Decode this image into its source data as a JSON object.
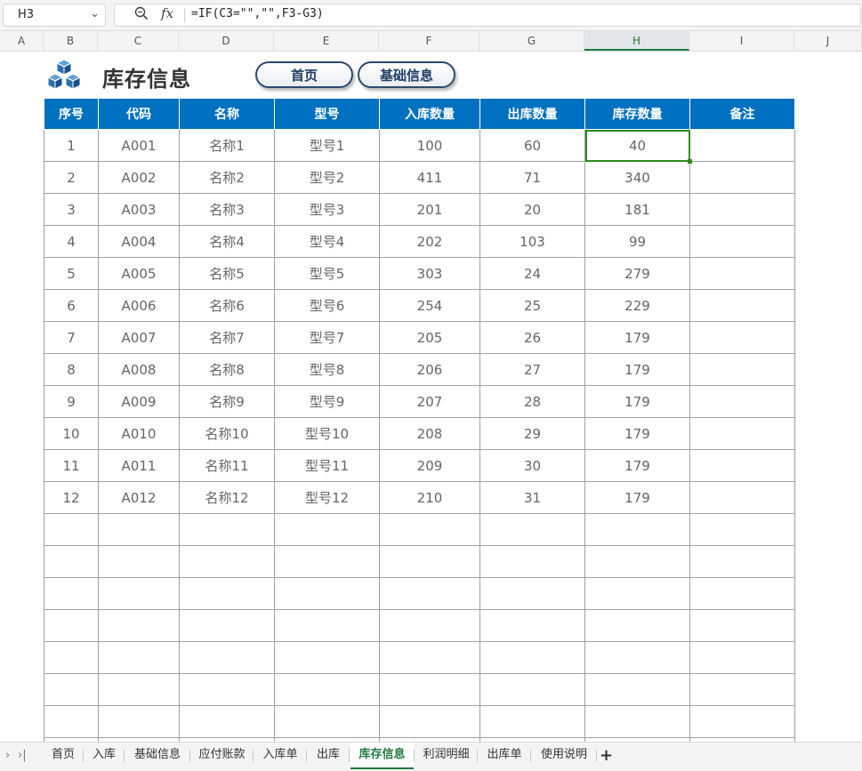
{
  "formula_bar": {
    "cell_ref": "H3",
    "formula": "=IF(C3=\"\",\"\",F3-G3)"
  },
  "columns": [
    "A",
    "B",
    "C",
    "D",
    "E",
    "F",
    "G",
    "H",
    "I",
    "J"
  ],
  "selected_column": "H",
  "title": "库存信息",
  "nav_buttons": [
    "首页",
    "基础信息"
  ],
  "table": {
    "headers": [
      "序号",
      "代码",
      "名称",
      "型号",
      "入库数量",
      "出库数量",
      "库存数量",
      "备注"
    ],
    "rows": [
      [
        "1",
        "A001",
        "名称1",
        "型号1",
        "100",
        "60",
        "40",
        ""
      ],
      [
        "2",
        "A002",
        "名称2",
        "型号2",
        "411",
        "71",
        "340",
        ""
      ],
      [
        "3",
        "A003",
        "名称3",
        "型号3",
        "201",
        "20",
        "181",
        ""
      ],
      [
        "4",
        "A004",
        "名称4",
        "型号4",
        "202",
        "103",
        "99",
        ""
      ],
      [
        "5",
        "A005",
        "名称5",
        "型号5",
        "303",
        "24",
        "279",
        ""
      ],
      [
        "6",
        "A006",
        "名称6",
        "型号6",
        "254",
        "25",
        "229",
        ""
      ],
      [
        "7",
        "A007",
        "名称7",
        "型号7",
        "205",
        "26",
        "179",
        ""
      ],
      [
        "8",
        "A008",
        "名称8",
        "型号8",
        "206",
        "27",
        "179",
        ""
      ],
      [
        "9",
        "A009",
        "名称9",
        "型号9",
        "207",
        "28",
        "179",
        ""
      ],
      [
        "10",
        "A010",
        "名称10",
        "型号10",
        "208",
        "29",
        "179",
        ""
      ],
      [
        "11",
        "A011",
        "名称11",
        "型号11",
        "209",
        "30",
        "179",
        ""
      ],
      [
        "12",
        "A012",
        "名称12",
        "型号12",
        "210",
        "31",
        "179",
        ""
      ]
    ],
    "empty_rows": 8,
    "active_cell": {
      "row": 0,
      "col": 6
    }
  },
  "sheet_tabs": [
    "首页",
    "入库",
    "基础信息",
    "应付账款",
    "入库单",
    "出库",
    "库存信息",
    "利润明细",
    "出库单",
    "使用说明"
  ],
  "active_tab": "库存信息",
  "icons": {
    "zoom": "zoom-icon",
    "fx": "fx-icon",
    "add_sheet": "plus-icon",
    "dropdown": "chevron-down-icon",
    "logo": "cubes-icon"
  },
  "colors": {
    "header_bg": "#0070c0",
    "accent": "#1f7a3e",
    "button_border": "#2c4a6e"
  }
}
